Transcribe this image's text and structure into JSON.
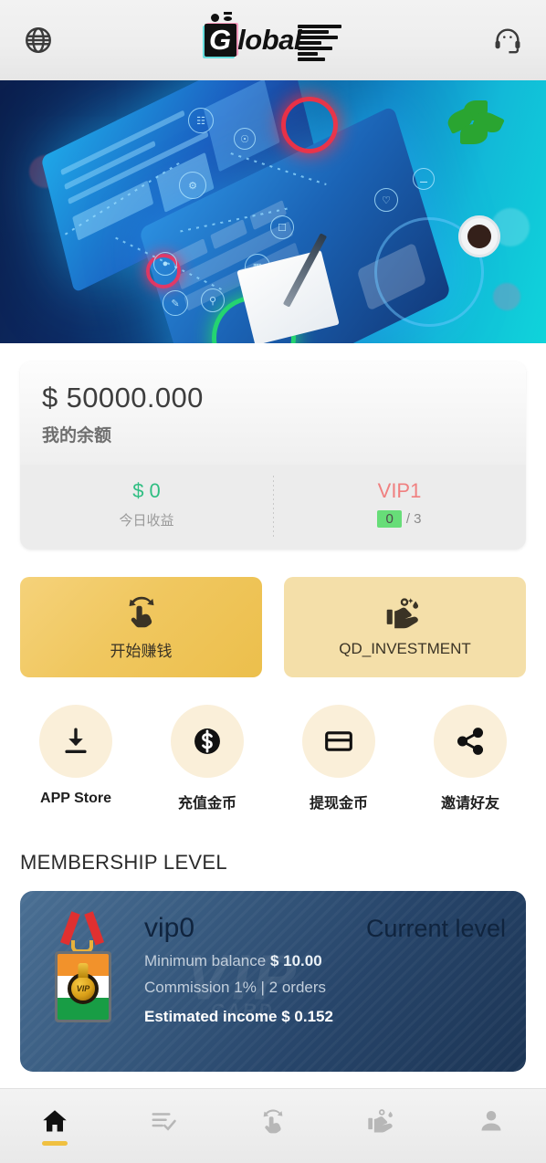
{
  "header": {
    "language_icon": "globe-icon",
    "support_icon": "headset-icon",
    "logo_letter": "G",
    "logo_text": "lobal"
  },
  "banner": {
    "alt": "digital technology laptop illustration"
  },
  "balance": {
    "amount": "$ 50000.000",
    "label": "我的余额",
    "today_income_value": "$ 0",
    "today_income_label": "今日收益",
    "vip_level": "VIP1",
    "orders_done": "0",
    "orders_total": "/ 3"
  },
  "actions": [
    {
      "label": "开始赚钱",
      "icon": "tap-gesture-icon"
    },
    {
      "label": "QD_INVESTMENT",
      "icon": "hand-money-icon"
    }
  ],
  "quick_links": [
    {
      "label": "APP Store",
      "icon": "download-icon"
    },
    {
      "label": "充值金币",
      "icon": "dollar-coin-icon"
    },
    {
      "label": "提现金币",
      "icon": "card-icon"
    },
    {
      "label": "邀请好友",
      "icon": "share-icon"
    }
  ],
  "membership": {
    "section_title": "MEMBERSHIP LEVEL",
    "watermark": "VIP",
    "watermark_sub": "CARD",
    "badge_text": "VIP",
    "level": "vip0",
    "status": "Current level",
    "minimum_balance_label": "Minimum balance",
    "minimum_balance_value": "$ 10.00",
    "commission": "Commission 1% | 2 orders",
    "estimated_income": "Estimated income $ 0.152"
  },
  "bottom_nav": [
    {
      "name": "home",
      "icon": "home-icon",
      "active": true
    },
    {
      "name": "orders",
      "icon": "list-check-icon",
      "active": false
    },
    {
      "name": "earn",
      "icon": "tap-gesture-icon",
      "active": false
    },
    {
      "name": "invest",
      "icon": "hand-money-icon",
      "active": false
    },
    {
      "name": "profile",
      "icon": "person-icon",
      "active": false
    }
  ],
  "colors": {
    "accent_gold": "#ecbf4c",
    "accent_gold_light": "#f4dfa9",
    "green": "#2fbe82",
    "chip_green": "#67dd78",
    "vip_red": "#f08080",
    "card_navy": "#1c3555"
  }
}
